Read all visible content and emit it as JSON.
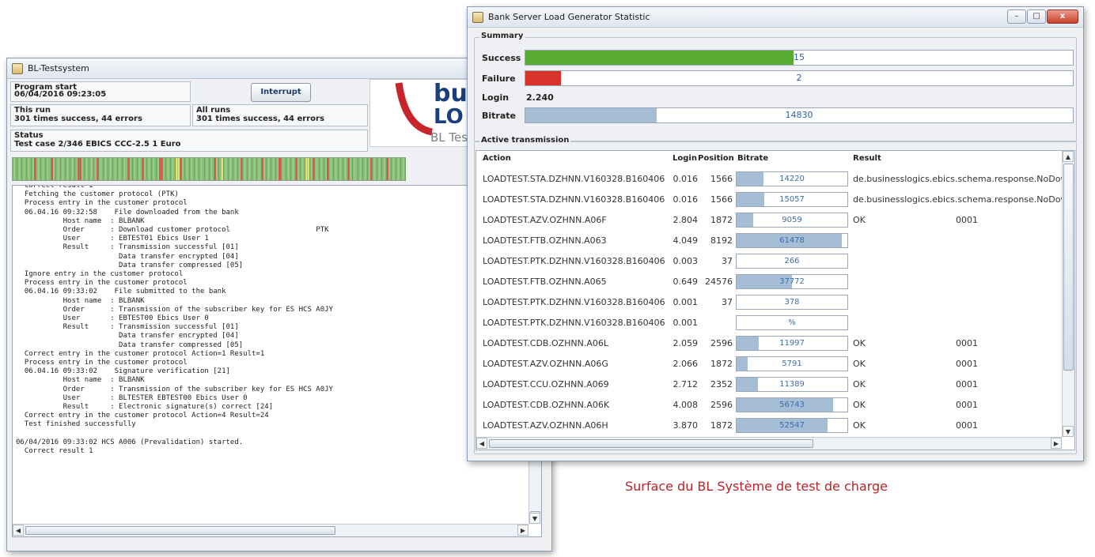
{
  "left_window": {
    "title": "BL-Testsystem",
    "program_start": {
      "label": "Program start",
      "value": "06/04/2016 09:23:05"
    },
    "interrupt_button": "Interrupt",
    "this_run": {
      "label": "This run",
      "value": "301 times success, 44 errors"
    },
    "all_runs": {
      "label": "All runs",
      "value": "301 times success, 44 errors"
    },
    "status": {
      "label": "Status",
      "value": "Test case 2/346 EBICS CCC-2.5 1 Euro"
    },
    "logo": {
      "line1": "bu",
      "line2": "LO",
      "line3": "BL Tes"
    },
    "progress_colors": {
      "success": "#8ac07a",
      "error": "#d9584c",
      "pending": "#e8e066"
    },
    "log_text": "  Correct result 1\n  Fetching the customer protocol (PTK)\n  Process entry in the customer protocol\n  06.04.16 09:32:58    File downloaded from the bank\n           Host name  : BLBANK\n           Order      : Download customer protocol                    PTK\n           User       : EBTEST01 Ebics User 1\n           Result     : Transmission successful [01]\n                        Data transfer encrypted [04]\n                        Data transfer compressed [05]\n  Ignore entry in the customer protocol\n  Process entry in the customer protocol\n  06.04.16 09:33:02    File submitted to the bank\n           Host name  : BLBANK\n           Order      : Transmission of the subscriber key for ES HCS A0JY\n           User       : EBTEST00 Ebics User 0\n           Result     : Transmission successful [01]\n                        Data transfer encrypted [04]\n                        Data transfer compressed [05]\n  Correct entry in the customer protocol Action=1 Result=1\n  Process entry in the customer protocol\n  06.04.16 09:33:02    Signature verification [21]\n           Host name  : BLBANK\n           Order      : Transmission of the subscriber key for ES HCS A0JY\n           User       : BLTESTER EBTEST00 Ebics User 0\n           Result     : Electronic signature(s) correct [24]\n  Correct entry in the customer protocol Action=4 Result=24\n  Test finished successfully\n\n06/04/2016 09:33:02 HCS A006 (Prevalidation) started.\n  Correct result 1"
  },
  "right_window": {
    "title": "Bank Server Load Generator Statistic",
    "window_buttons": {
      "minimize": "–",
      "maximize": "□",
      "close": "x"
    },
    "summary": {
      "label": "Summary",
      "success_label": "Success",
      "success_value": "15",
      "success_fraction": 0.49,
      "success_color": "#5aab33",
      "failure_label": "Failure",
      "failure_value": "2",
      "failure_fraction": 0.065,
      "failure_color": "#d8332b",
      "login_label": "Login",
      "login_value": "2.240",
      "bitrate_label": "Bitrate",
      "bitrate_value": "14830",
      "bitrate_fraction": 0.24,
      "bitrate_color": "#a6bdd6"
    },
    "active": {
      "label": "Active transmission",
      "headers": {
        "action": "Action",
        "login": "Login",
        "position": "Position",
        "bitrate": "Bitrate",
        "result": "Result"
      },
      "rows": [
        {
          "action": "LOADTEST.STA.DZHNN.V160328.B160406",
          "login": "0.016",
          "position": "1566",
          "bitrate": "14220",
          "fill": 0.24,
          "result": "de.businesslogics.ebics.schema.response.NoDow",
          "code": ""
        },
        {
          "action": "LOADTEST.STA.DZHNN.V160328.B160406",
          "login": "0.016",
          "position": "1566",
          "bitrate": "15057",
          "fill": 0.25,
          "result": "de.businesslogics.ebics.schema.response.NoDow",
          "code": ""
        },
        {
          "action": "LOADTEST.AZV.OZHNN.A06F",
          "login": "2.804",
          "position": "1872",
          "bitrate": "9059",
          "fill": 0.15,
          "result": "OK",
          "code": "0001"
        },
        {
          "action": "LOADTEST.FTB.OZHNN.A063",
          "login": "4.049",
          "position": "8192",
          "bitrate": "61478",
          "fill": 0.95,
          "result": "",
          "code": ""
        },
        {
          "action": "LOADTEST.PTK.DZHNN.V160328.B160406",
          "login": "0.003",
          "position": "37",
          "bitrate": "266",
          "fill": 0.0,
          "result": "",
          "code": ""
        },
        {
          "action": "LOADTEST.FTB.OZHNN.A065",
          "login": "0.649",
          "position": "24576",
          "bitrate": "37772",
          "fill": 0.5,
          "result": "",
          "code": ""
        },
        {
          "action": "LOADTEST.PTK.DZHNN.V160328.B160406",
          "login": "0.001",
          "position": "37",
          "bitrate": "378",
          "fill": 0.0,
          "result": "",
          "code": ""
        },
        {
          "action": "LOADTEST.PTK.DZHNN.V160328.B160406",
          "login": "0.001",
          "position": "",
          "bitrate": "%",
          "fill": 0.0,
          "result": "",
          "code": ""
        },
        {
          "action": "LOADTEST.CDB.OZHNN.A06L",
          "login": "2.059",
          "position": "2596",
          "bitrate": "11997",
          "fill": 0.2,
          "result": "OK",
          "code": "0001"
        },
        {
          "action": "LOADTEST.AZV.OZHNN.A06G",
          "login": "2.066",
          "position": "1872",
          "bitrate": "5791",
          "fill": 0.1,
          "result": "OK",
          "code": "0001"
        },
        {
          "action": "LOADTEST.CCU.OZHNN.A069",
          "login": "2.712",
          "position": "2352",
          "bitrate": "11389",
          "fill": 0.19,
          "result": "OK",
          "code": "0001"
        },
        {
          "action": "LOADTEST.CDB.OZHNN.A06K",
          "login": "4.008",
          "position": "2596",
          "bitrate": "56743",
          "fill": 0.87,
          "result": "OK",
          "code": "0001"
        },
        {
          "action": "LOADTEST.AZV.OZHNN.A06H",
          "login": "3.870",
          "position": "1872",
          "bitrate": "52547",
          "fill": 0.82,
          "result": "OK",
          "code": "0001"
        }
      ]
    }
  },
  "caption": "Surface du BL Système de test de charge"
}
